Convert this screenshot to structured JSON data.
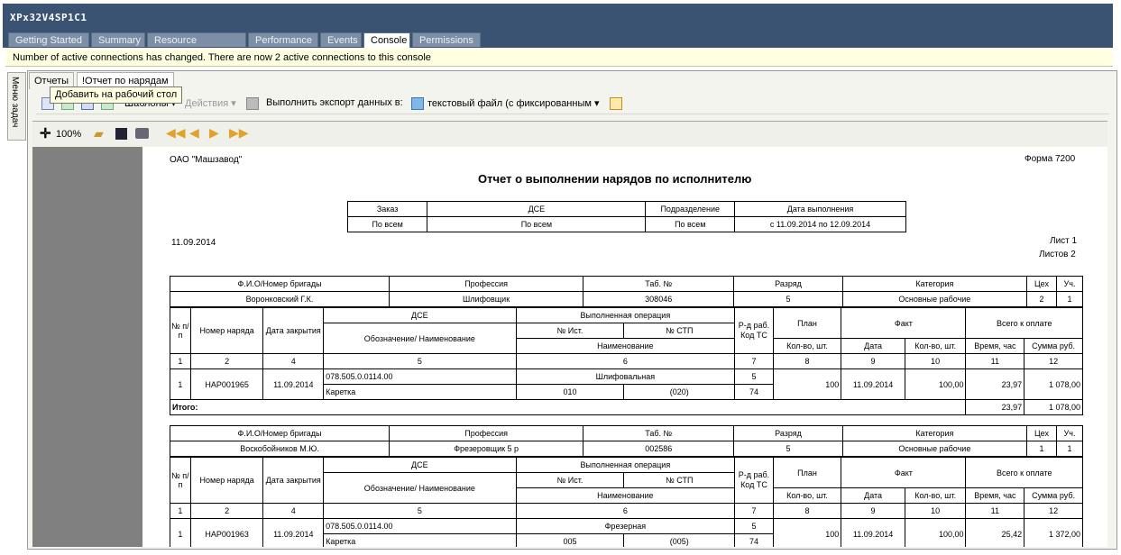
{
  "window": {
    "title": "XPx32V4SP1C1"
  },
  "tabs": [
    "Getting Started",
    "Summary",
    "Resource Allocation",
    "Performance",
    "Events",
    "Console",
    "Permissions"
  ],
  "notification": "Number of active connections has changed. There are now 2 active connections to this console",
  "side_tab": "Меню задач",
  "inner_tabs": [
    "Отчеты",
    "!Отчет по нарядам"
  ],
  "tooltip": "Добавить на рабочий стол",
  "toolbar1": {
    "templates": "Шаблоны",
    "actions": "Действия",
    "export_label": "Выполнить экспорт данных в:",
    "export_value": "текстовый файл (с фиксированным"
  },
  "toolbar2": {
    "zoom": "100%"
  },
  "report": {
    "org": "ОАО \"Машзавод\"",
    "form": "Форма 7200",
    "title": "Отчет о выполнении нарядов по исполнителю",
    "date": "11.09.2014",
    "sheet": "Лист 1",
    "sheets": "Листов 2",
    "filter": {
      "headers": [
        "Заказ",
        "ДСЕ",
        "Подразделение",
        "Дата выполнения"
      ],
      "values": [
        "По всем",
        "По всем",
        "По всем",
        "с 11.09.2014  по 12.09.2014"
      ]
    },
    "labels": {
      "fio": "Ф.И.О/Номер бригады",
      "prof": "Профессия",
      "tab": "Таб. №",
      "rank": "Разряд",
      "cat": "Категория",
      "shop": "Цех",
      "sect": "Уч.",
      "num": "№ п/п",
      "order": "Номер наряда",
      "closed": "Дата закрытия",
      "dse": "ДСЕ",
      "dse_sub": "Обозначение/ Наименование",
      "op": "Выполненная операция",
      "src": "№ Ист.",
      "stp": "№ СТП",
      "opname": "Наименование",
      "rate": "Р-д раб. Код ТС",
      "plan": "План",
      "fact": "Факт",
      "pay": "Всего к оплате",
      "qty": "Кол-во, шт.",
      "factdate": "Дата",
      "factqty": "Кол-во, шт.",
      "time": "Время, час",
      "sum": "Сумма руб.",
      "colnums": [
        "1",
        "2",
        "4",
        "5",
        "6",
        "7",
        "8",
        "9",
        "10",
        "11",
        "12"
      ],
      "total": "Итого:"
    },
    "workers": [
      {
        "fio": "Воронковский Г.К.",
        "prof": "Шлифовщик",
        "tab": "308046",
        "rank": "5",
        "cat": "Основные рабочие",
        "shop": "2",
        "sect": "1",
        "row": {
          "n": "1",
          "order": "НАР001965",
          "closed": "11.09.2014",
          "code": "078.505.0.0114.00",
          "name": "Каретка",
          "op": "Шлифовальная",
          "src": "010",
          "stp": "(020)",
          "rank": "5",
          "ts": "74",
          "plan": "100",
          "date": "11.09.2014",
          "qty": "100,00",
          "time": "23,97",
          "sum": "1 078,00"
        },
        "total": {
          "time": "23,97",
          "sum": "1 078,00"
        }
      },
      {
        "fio": "Воскобойников М.Ю.",
        "prof": "Фрезеровщик 5 р",
        "tab": "002586",
        "rank": "5",
        "cat": "Основные рабочие",
        "shop": "1",
        "sect": "1",
        "row": {
          "n": "1",
          "order": "НАР001963",
          "closed": "11.09.2014",
          "code": "078.505.0.0114.00",
          "name": "Каретка",
          "op": "Фрезерная",
          "src": "005",
          "stp": "(005)",
          "rank": "5",
          "ts": "74",
          "plan": "100",
          "date": "11.09.2014",
          "qty": "100,00",
          "time": "25,42",
          "sum": "1 372,00"
        }
      }
    ]
  }
}
